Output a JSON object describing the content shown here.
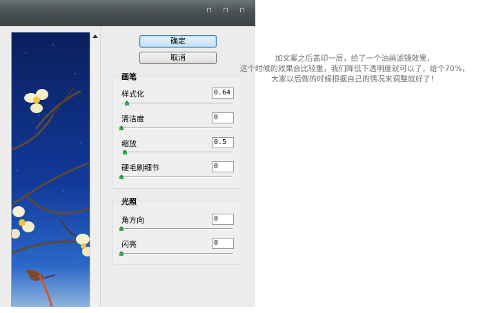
{
  "dialog": {
    "buttons": {
      "ok_label": "确定",
      "cancel_label": "取消"
    },
    "brush": {
      "title": "画笔",
      "controls": [
        {
          "label": "样式化",
          "value": "0.64",
          "level": 0.06
        },
        {
          "label": "清洁度",
          "value": "0",
          "level": 0.0
        },
        {
          "label": "缩放",
          "value": "0.5",
          "level": 0.03
        },
        {
          "label": "硬毛刷细节",
          "value": "0",
          "level": 0.0
        }
      ]
    },
    "lighting": {
      "title": "光照",
      "controls": [
        {
          "label": "角方向",
          "value": "0",
          "level": 0.0
        },
        {
          "label": "闪亮",
          "value": "0",
          "level": 0.0
        }
      ]
    }
  },
  "note": {
    "lines": [
      "加文案之后盖印一层，给了一个油画滤镜效果，",
      "这个时候的效果会比较重，我们降低下透明度就可以了，给个70%，",
      "大家以后做的时候根据自己的情况来调整就好了！"
    ]
  },
  "icons": {
    "title_controls": [
      "minimize-icon",
      "maximize-icon",
      "close-icon"
    ],
    "scroll": "scroll-up-arrow-icon",
    "slider": "slider-thumb-icon"
  },
  "colors": {
    "primary_button": "#bfe0f5",
    "slider_thumb": "#38a84a",
    "note_text": "#707070"
  }
}
